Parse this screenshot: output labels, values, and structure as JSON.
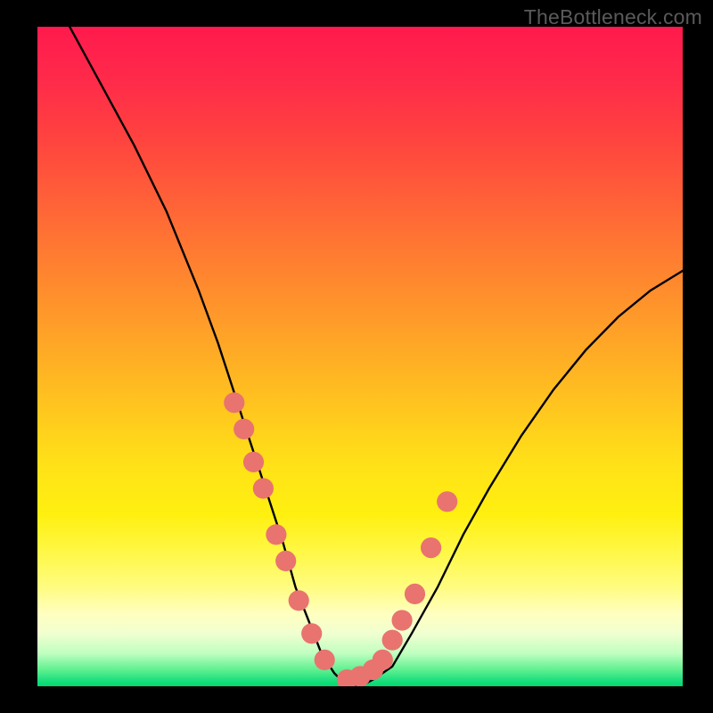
{
  "watermark": {
    "text": "TheBottleneck.com"
  },
  "chart_data": {
    "type": "line",
    "title": "",
    "xlabel": "",
    "ylabel": "",
    "xlim": [
      0,
      100
    ],
    "ylim": [
      0,
      100
    ],
    "grid": false,
    "series": [
      {
        "name": "curve",
        "x": [
          5,
          10,
          15,
          20,
          25,
          28,
          30,
          33,
          35,
          38,
          40,
          42,
          44,
          46,
          48,
          50,
          52,
          55,
          58,
          62,
          66,
          70,
          75,
          80,
          85,
          90,
          95,
          100
        ],
        "y": [
          100,
          91,
          82,
          72,
          60,
          52,
          46,
          37,
          31,
          22,
          15,
          10,
          5,
          2,
          0,
          0,
          1,
          3,
          8,
          15,
          23,
          30,
          38,
          45,
          51,
          56,
          60,
          63
        ]
      }
    ],
    "markers": [
      {
        "name": "dots-left",
        "x": [
          30.5,
          32,
          33.5,
          35,
          37,
          38.5,
          40.5,
          42.5,
          44.5
        ],
        "y": [
          43,
          39,
          34,
          30,
          23,
          19,
          13,
          8,
          4
        ]
      },
      {
        "name": "dots-right",
        "x": [
          48,
          50,
          52,
          53.5,
          55,
          56.5,
          58.5,
          61,
          63.5
        ],
        "y": [
          1,
          1.5,
          2.5,
          4,
          7,
          10,
          14,
          21,
          28
        ]
      }
    ],
    "marker_color": "#e9736f",
    "marker_radius_pct": 1.6
  }
}
